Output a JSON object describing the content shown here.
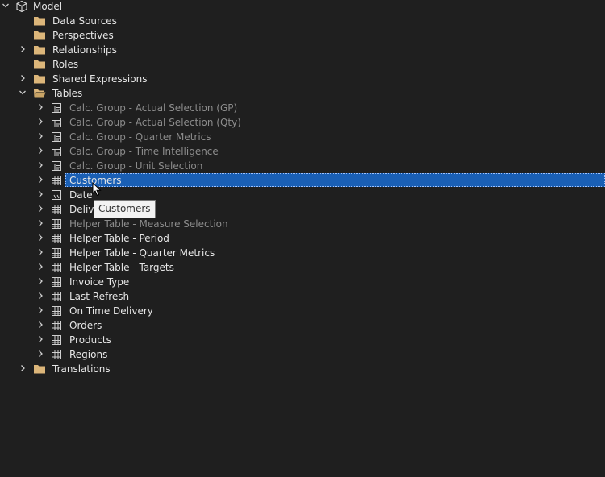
{
  "tree": {
    "root": {
      "label": "Model",
      "expanded": true
    },
    "folders_top": [
      {
        "label": "Data Sources",
        "expandable": false
      },
      {
        "label": "Perspectives",
        "expandable": false
      },
      {
        "label": "Relationships",
        "expandable": true
      },
      {
        "label": "Roles",
        "expandable": false
      },
      {
        "label": "Shared Expressions",
        "expandable": true
      }
    ],
    "tables_folder": {
      "label": "Tables",
      "expanded": true
    },
    "tables": [
      {
        "label": "Calc. Group - Actual Selection (GP)",
        "kind": "calc",
        "dim": true
      },
      {
        "label": "Calc. Group - Actual Selection (Qty)",
        "kind": "calc",
        "dim": true
      },
      {
        "label": "Calc. Group - Quarter Metrics",
        "kind": "calc",
        "dim": true
      },
      {
        "label": "Calc. Group - Time Intelligence",
        "kind": "calc",
        "dim": true
      },
      {
        "label": "Calc. Group - Unit Selection",
        "kind": "calc",
        "dim": true
      },
      {
        "label": "Customers",
        "kind": "table",
        "dim": false,
        "selected": true
      },
      {
        "label": "Date",
        "kind": "date",
        "dim": false
      },
      {
        "label": "Delive",
        "kind": "table",
        "dim": false
      },
      {
        "label": "Helper Table - Measure Selection",
        "kind": "table",
        "dim": true
      },
      {
        "label": "Helper Table - Period",
        "kind": "table",
        "dim": false
      },
      {
        "label": "Helper Table - Quarter Metrics",
        "kind": "table",
        "dim": false
      },
      {
        "label": "Helper Table - Targets",
        "kind": "table",
        "dim": false
      },
      {
        "label": "Invoice Type",
        "kind": "table",
        "dim": false
      },
      {
        "label": "Last Refresh",
        "kind": "table",
        "dim": false
      },
      {
        "label": "On Time Delivery",
        "kind": "table",
        "dim": false
      },
      {
        "label": "Orders",
        "kind": "table",
        "dim": false
      },
      {
        "label": "Products",
        "kind": "table",
        "dim": false
      },
      {
        "label": "Regions",
        "kind": "table",
        "dim": false
      }
    ],
    "translations": {
      "label": "Translations",
      "expandable": true
    }
  },
  "tooltip": {
    "text": "Customers"
  },
  "colors": {
    "background": "#1f1f1f",
    "selection": "#1a5fb4",
    "folder": "#dcb67a",
    "text": "#e6e6e6",
    "dim_text": "#8c8c8c"
  }
}
